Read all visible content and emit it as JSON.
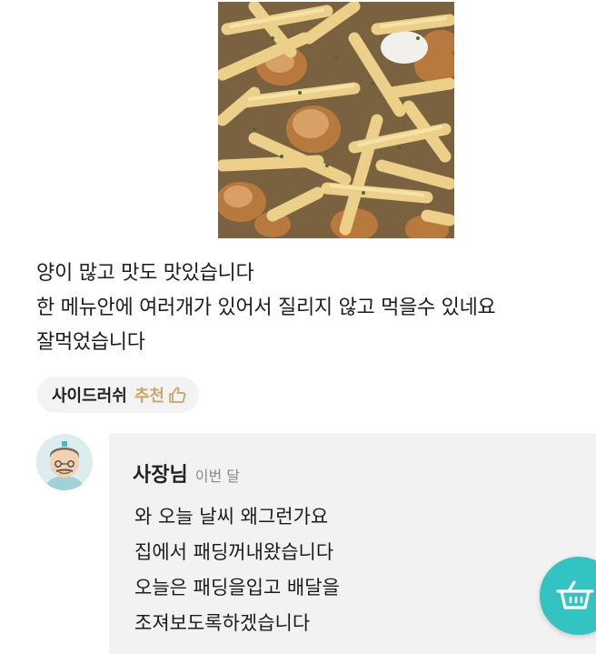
{
  "review": {
    "lines": [
      "양이 많고 맛도 맛있습니다",
      "한 메뉴안에 여러개가 있어서 질리지 않고 먹을수 있네요",
      "잘먹었습니다"
    ],
    "recommended_menu": "사이드러쉬",
    "recommend_label": "추천"
  },
  "reply": {
    "author": "사장님",
    "date": "이번 달",
    "lines": [
      "와 오늘 날씨 왜그런가요",
      "집에서 패딩꺼내왔습니다",
      "오늘은 패딩을입고 배달을",
      "조져보도록하겠습니다"
    ]
  },
  "icons": {
    "recommend": "thumbs-up-icon",
    "cart": "shopping-basket-icon",
    "avatar": "owner-avatar"
  },
  "colors": {
    "accent": "#33c3c2",
    "recommend": "#c9a66b",
    "reply_bg": "#f2f2f2"
  }
}
